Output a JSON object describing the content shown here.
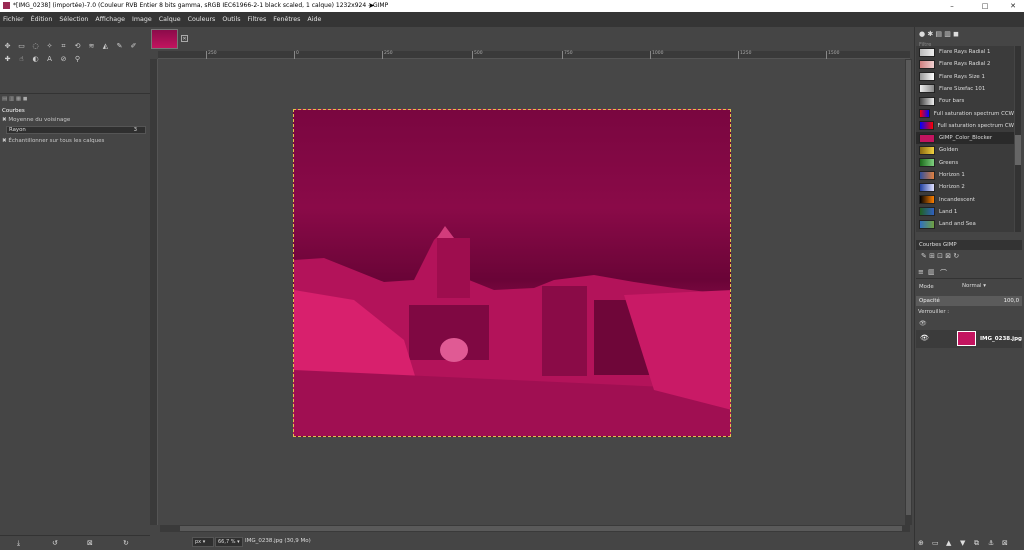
{
  "window": {
    "title": "*[IMG_0238] (importée)-7.0 (Couleur RVB Entier 8 bits gamma, sRGB IEC61966-2-1 black scaled, 1 calque) 1232x924 – GIMP",
    "minimize": "–",
    "maximize": "□",
    "close": "✕"
  },
  "menu": [
    "Fichier",
    "Édition",
    "Sélection",
    "Affichage",
    "Image",
    "Calque",
    "Couleurs",
    "Outils",
    "Filtres",
    "Fenêtres",
    "Aide"
  ],
  "tool_options": {
    "title": "Courbes",
    "sample_average": "Moyenne du voisinage",
    "radius_label": "Rayon",
    "radius_value": "3",
    "sample_merged": "Échantillonner sur tous les calques"
  },
  "rulers": {
    "h_ticks": [
      "250",
      "0",
      "250",
      "500",
      "750",
      "1000",
      "1250",
      "1500"
    ]
  },
  "statusbar": {
    "unit": "px",
    "zoom": "66,7 %",
    "message": "IMG_0238.jpg (30,9 Mo)"
  },
  "gradients": {
    "filter_placeholder": "Filtre",
    "items": [
      {
        "name": "Flare Rays Radial 1",
        "c1": "#bbbbbb",
        "c2": "#eeeeee"
      },
      {
        "name": "Flare Rays Radial 2",
        "c1": "#d08080",
        "c2": "#f0d0d0"
      },
      {
        "name": "Flare Rays Size 1",
        "c1": "#999999",
        "c2": "#ffffff"
      },
      {
        "name": "Flare Sizefac 101",
        "c1": "#eeeeee",
        "c2": "#888888"
      },
      {
        "name": "Four bars",
        "c1": "#444444",
        "c2": "#eeeeee"
      },
      {
        "name": "Full saturation spectrum CCW",
        "c1": "#ff0000",
        "c2": "#0000ff"
      },
      {
        "name": "Full saturation spectrum CW",
        "c1": "#0000ff",
        "c2": "#ff0000"
      },
      {
        "name": "GIMP_Color_Blocker",
        "c1": "#c3145f",
        "c2": "#c3145f",
        "selected": true
      },
      {
        "name": "Golden",
        "c1": "#8a6a10",
        "c2": "#f0d040"
      },
      {
        "name": "Greens",
        "c1": "#1a6a1a",
        "c2": "#80d080"
      },
      {
        "name": "Horizon 1",
        "c1": "#3050a0",
        "c2": "#e08040"
      },
      {
        "name": "Horizon 2",
        "c1": "#2040a0",
        "c2": "#e0e0ff"
      },
      {
        "name": "Incandescent",
        "c1": "#000000",
        "c2": "#ff8000"
      },
      {
        "name": "Land 1",
        "c1": "#206020",
        "c2": "#3060c0"
      },
      {
        "name": "Land and Sea",
        "c1": "#3070c0",
        "c2": "#70a040"
      }
    ],
    "current": "Courbes GIMP"
  },
  "layers": {
    "mode_label": "Mode",
    "mode_value": "Normal",
    "opacity_label": "Opacité",
    "opacity_value": "100,0",
    "lock_label": "Verrouiller :",
    "layer_name": "IMG_0238.jpg"
  },
  "colors": {
    "accent": "#c3145f",
    "fg": "#000000",
    "bg": "#ffffff"
  }
}
